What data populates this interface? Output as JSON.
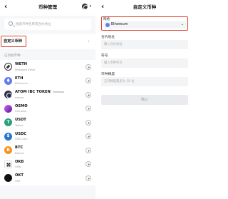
{
  "left": {
    "title": "币种管理",
    "search_placeholder": "搜索币种名称或合约地址",
    "custom_label": "自定义币种",
    "section_label": "已添加币种",
    "tokens": [
      {
        "symbol": "WETH",
        "tag": "",
        "sub": "Wrapped Ether",
        "icon": "weth-icon"
      },
      {
        "symbol": "ETH",
        "tag": "",
        "sub": "Ethereum",
        "icon": "eth-icon"
      },
      {
        "symbol": "ATOM IBC TOKEN",
        "tag": "Osmosis",
        "sub": "uatom",
        "icon": "atom-icon"
      },
      {
        "symbol": "OSMO",
        "tag": "",
        "sub": "Osmosis",
        "icon": "osmo-icon"
      },
      {
        "symbol": "USDT",
        "tag": "",
        "sub": "Tether",
        "icon": "usdt-icon"
      },
      {
        "symbol": "USDC",
        "tag": "",
        "sub": "USD Coin",
        "icon": "usdc-icon"
      },
      {
        "symbol": "BTC",
        "tag": "",
        "sub": "Bitcoin",
        "icon": "btc-icon"
      },
      {
        "symbol": "OKB",
        "tag": "",
        "sub": "OKB",
        "icon": "okb-icon"
      },
      {
        "symbol": "OKT",
        "tag": "",
        "sub": "OKT",
        "icon": "okt-icon"
      }
    ]
  },
  "right": {
    "title": "自定义币种",
    "network_label": "网络",
    "network_value": "Ethereum",
    "contract_label": "合约地址",
    "contract_placeholder": "输入合约地址",
    "symbol_label": "符号",
    "symbol_placeholder": "输入币种符号",
    "decimals_label": "币种精度",
    "decimals_placeholder": "支持精度最多为 18 位",
    "confirm_label": "确认"
  },
  "colors": {
    "highlight": "#d9432f",
    "eth": "#627eea"
  }
}
